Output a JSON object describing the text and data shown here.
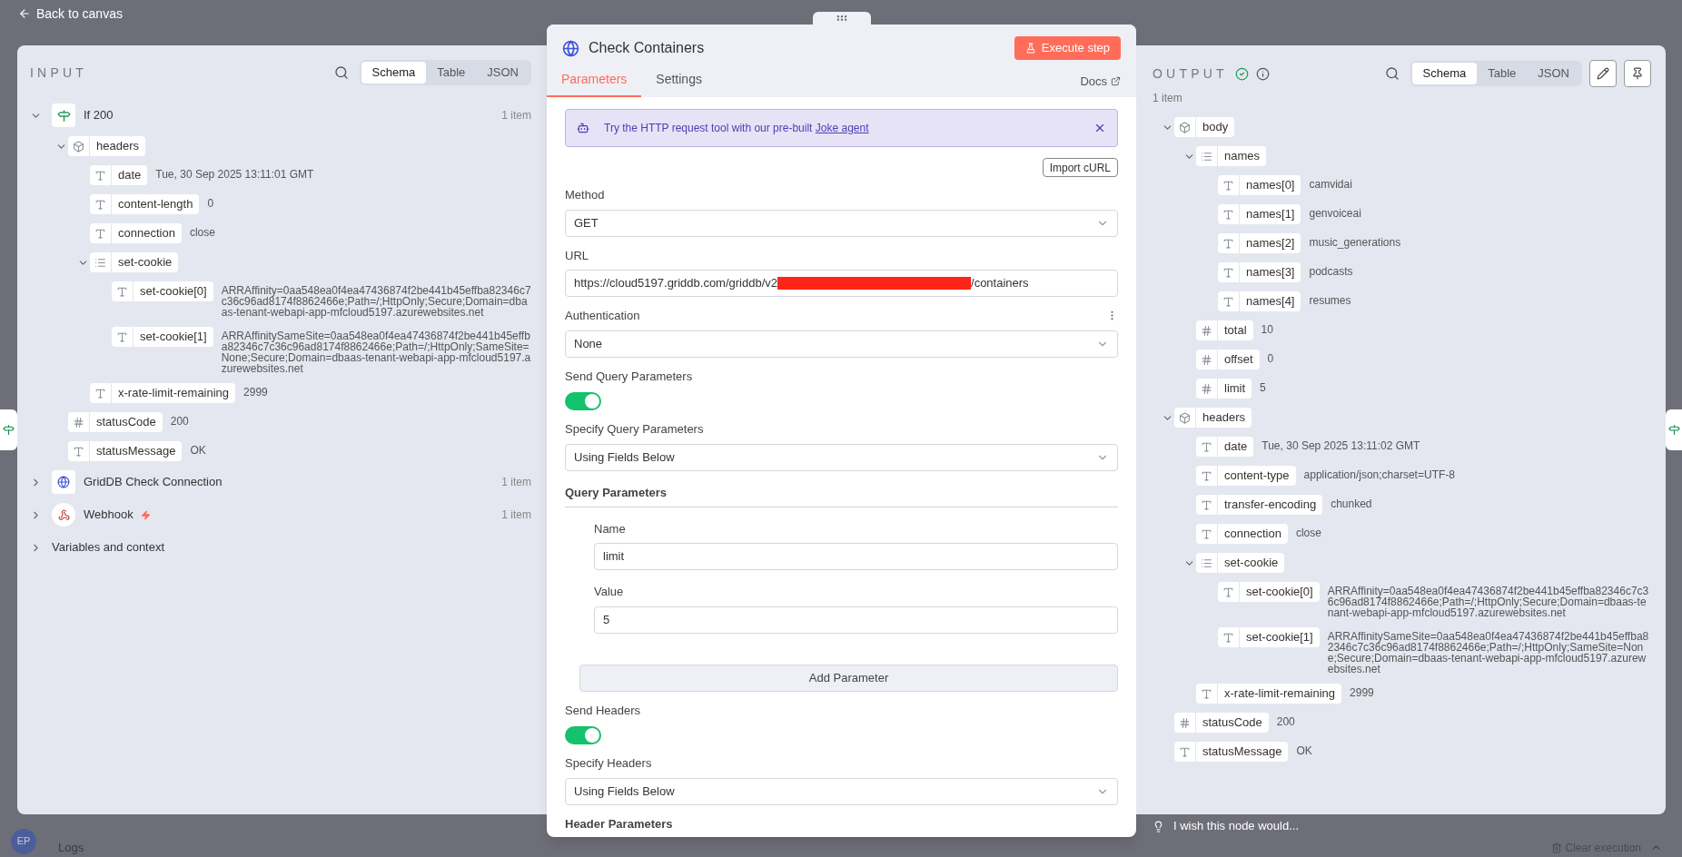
{
  "top_bar": {
    "back_link": "Back to canvas"
  },
  "input_panel": {
    "title": "INPUT",
    "view_tabs": [
      {
        "label": "Schema",
        "selected": true
      },
      {
        "label": "Table",
        "selected": false
      },
      {
        "label": "JSON",
        "selected": false
      }
    ],
    "sources": [
      {
        "kind": "if",
        "label": "If 200",
        "count": "1 item",
        "expanded": true,
        "trigger": false,
        "children": [
          {
            "kind": "object",
            "name": "headers",
            "expanded": true,
            "children": [
              {
                "kind": "string",
                "name": "date",
                "value": "Tue, 30 Sep 2025 13:11:01 GMT"
              },
              {
                "kind": "string",
                "name": "content-length",
                "value": "0"
              },
              {
                "kind": "string",
                "name": "connection",
                "value": "close"
              },
              {
                "kind": "array",
                "name": "set-cookie",
                "expanded": true,
                "children": [
                  {
                    "kind": "string",
                    "name": "set-cookie[0]",
                    "value": "ARRAffinity=0aa548ea0f4ea47436874f2be441b45effba82346c7c36c96ad8174f8862466e;Path=/;HttpOnly;Secure;Domain=dbaas-tenant-webapi-app-mfcloud5197.azurewebsites.net"
                  },
                  {
                    "kind": "string",
                    "name": "set-cookie[1]",
                    "value": "ARRAffinitySameSite=0aa548ea0f4ea47436874f2be441b45effba82346c7c36c96ad8174f8862466e;Path=/;HttpOnly;SameSite=None;Secure;Domain=dbaas-tenant-webapi-app-mfcloud5197.azurewebsites.net"
                  }
                ]
              },
              {
                "kind": "string",
                "name": "x-rate-limit-remaining",
                "value": "2999"
              }
            ]
          },
          {
            "kind": "number",
            "name": "statusCode",
            "value": "200"
          },
          {
            "kind": "string",
            "name": "statusMessage",
            "value": "OK"
          }
        ]
      },
      {
        "kind": "http",
        "label": "GridDB Check Connection",
        "count": "1 item",
        "expanded": false,
        "trigger": false
      },
      {
        "kind": "webhook",
        "label": "Webhook",
        "count": "1 item",
        "expanded": false,
        "trigger": true
      },
      {
        "kind": "context",
        "label": "Variables and context",
        "expanded": false,
        "trigger": false
      }
    ]
  },
  "node_panel": {
    "title": "Check Containers",
    "execute_button": "Execute step",
    "tabs": [
      {
        "label": "Parameters",
        "selected": true
      },
      {
        "label": "Settings",
        "selected": false
      }
    ],
    "docs_link": "Docs",
    "banner": {
      "text": "Try the HTTP request tool with our pre-built",
      "link": "Joke agent"
    },
    "import_button": "Import cURL",
    "fields": [
      {
        "kind": "select",
        "label": "Method",
        "value": "GET",
        "options_menu": false
      },
      {
        "kind": "url",
        "label": "URL",
        "prefix": "https://cloud5197.griddb.com/griddb/v2",
        "redacted": true,
        "suffix": "/containers"
      },
      {
        "kind": "select",
        "label": "Authentication",
        "value": "None",
        "options_menu": true
      },
      {
        "kind": "toggle",
        "label": "Send Query Parameters",
        "on": true
      },
      {
        "kind": "select",
        "label": "Specify Query Parameters",
        "value": "Using Fields Below",
        "options_menu": false
      },
      {
        "kind": "group",
        "title": "Query Parameters",
        "fields": [
          {
            "label": "Name",
            "value": "limit"
          },
          {
            "label": "Value",
            "value": "5"
          }
        ],
        "button": "Add Parameter"
      },
      {
        "kind": "toggle",
        "label": "Send Headers",
        "on": true
      },
      {
        "kind": "select",
        "label": "Specify Headers",
        "value": "Using Fields Below",
        "options_menu": false
      },
      {
        "kind": "heading",
        "title": "Header Parameters"
      }
    ]
  },
  "output_panel": {
    "title": "OUTPUT",
    "success": true,
    "view_tabs": [
      {
        "label": "Schema",
        "selected": true
      },
      {
        "label": "Table",
        "selected": false
      },
      {
        "label": "JSON",
        "selected": false
      }
    ],
    "count": "1 item",
    "tree": [
      {
        "kind": "object",
        "name": "body",
        "expanded": true,
        "children": [
          {
            "kind": "array",
            "name": "names",
            "expanded": true,
            "children": [
              {
                "kind": "string",
                "name": "names[0]",
                "value": "camvidai"
              },
              {
                "kind": "string",
                "name": "names[1]",
                "value": "genvoiceai"
              },
              {
                "kind": "string",
                "name": "names[2]",
                "value": "music_generations"
              },
              {
                "kind": "string",
                "name": "names[3]",
                "value": "podcasts"
              },
              {
                "kind": "string",
                "name": "names[4]",
                "value": "resumes"
              }
            ]
          },
          {
            "kind": "number",
            "name": "total",
            "value": "10"
          },
          {
            "kind": "number",
            "name": "offset",
            "value": "0"
          },
          {
            "kind": "number",
            "name": "limit",
            "value": "5"
          }
        ]
      },
      {
        "kind": "object",
        "name": "headers",
        "expanded": true,
        "children": [
          {
            "kind": "string",
            "name": "date",
            "value": "Tue, 30 Sep 2025 13:11:02 GMT"
          },
          {
            "kind": "string",
            "name": "content-type",
            "value": "application/json;charset=UTF-8"
          },
          {
            "kind": "string",
            "name": "transfer-encoding",
            "value": "chunked"
          },
          {
            "kind": "string",
            "name": "connection",
            "value": "close"
          },
          {
            "kind": "array",
            "name": "set-cookie",
            "expanded": true,
            "children": [
              {
                "kind": "string",
                "name": "set-cookie[0]",
                "value": "ARRAffinity=0aa548ea0f4ea47436874f2be441b45effba82346c7c36c96ad8174f8862466e;Path=/;HttpOnly;Secure;Domain=dbaas-tenant-webapi-app-mfcloud5197.azurewebsites.net"
              },
              {
                "kind": "string",
                "name": "set-cookie[1]",
                "value": "ARRAffinitySameSite=0aa548ea0f4ea47436874f2be441b45effba82346c7c36c96ad8174f8862466e;Path=/;HttpOnly;SameSite=None;Secure;Domain=dbaas-tenant-webapi-app-mfcloud5197.azurewebsites.net"
              }
            ]
          },
          {
            "kind": "string",
            "name": "x-rate-limit-remaining",
            "value": "2999"
          }
        ]
      },
      {
        "kind": "number",
        "name": "statusCode",
        "value": "200"
      },
      {
        "kind": "string",
        "name": "statusMessage",
        "value": "OK"
      }
    ]
  },
  "feedback": {
    "placeholder": "I wish this node would..."
  },
  "bottom": {
    "avatar": "EP",
    "logs": "Logs",
    "clear_execution": "Clear execution"
  }
}
